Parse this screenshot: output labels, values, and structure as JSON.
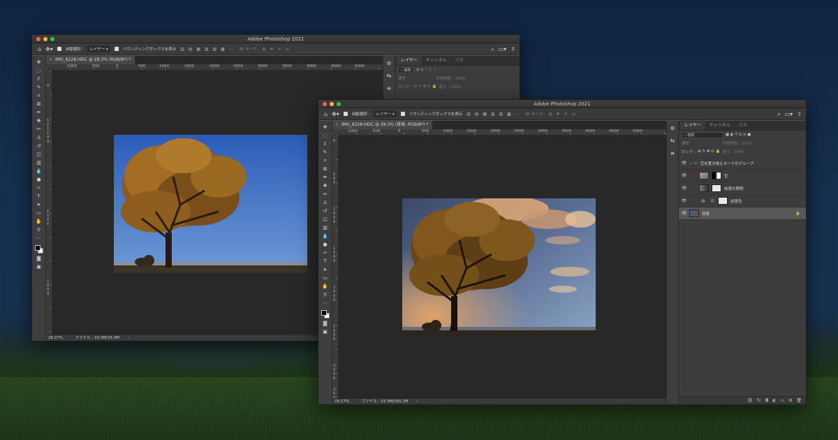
{
  "desktop": {
    "description": "night landscape wallpaper"
  },
  "window_back": {
    "title": "Adobe Photoshop 2021",
    "options": {
      "auto_select_label": "自動選択 :",
      "layer_select": "レイヤー",
      "bbox_label": "バウンディングボックスを表示",
      "threed_mode": "3D モード:"
    },
    "doc_tab": "IMG_6228.HEIC @ 28.3% (RGB/8*) *",
    "ruler_h": [
      "1000",
      "500",
      "0",
      "500",
      "1000",
      "1500",
      "2000",
      "2500",
      "3000",
      "3500",
      "4000",
      "4500",
      "5000"
    ],
    "ruler_v": [
      "0",
      "5",
      "0",
      "1",
      "0",
      "0",
      "0",
      "1",
      "5",
      "0",
      "0",
      "2",
      "0",
      "0",
      "0"
    ],
    "status": {
      "zoom": "28.27%",
      "file": "ファイル : 33.3M/33.3M"
    },
    "panel": {
      "tabs": [
        "レイヤー",
        "チャンネル",
        "パス"
      ],
      "search": "種類",
      "blend": "通常",
      "opacity": "不透明度 : 100%",
      "lock": "ロック :",
      "fill": "塗り : 100%"
    }
  },
  "window_front": {
    "title": "Adobe Photoshop 2021",
    "options": {
      "auto_select_label": "自動選択 :",
      "layer_select": "レイヤー",
      "bbox_label": "バウンディングボックスを表示",
      "threed_mode": "3D モード:"
    },
    "doc_tab": "IMG_6228.HEIC @ 28.3% (背景, RGB/8*) *",
    "ruler_h": [
      "1000",
      "500",
      "0",
      "500",
      "1000",
      "1500",
      "2000",
      "2500",
      "3000",
      "3500",
      "4000",
      "4500",
      "5000"
    ],
    "ruler_v": [
      "0",
      "5",
      "0",
      "0",
      "1",
      "0",
      "0",
      "0",
      "1",
      "5",
      "0",
      "0",
      "2",
      "0",
      "0",
      "0",
      "2",
      "5",
      "0",
      "0",
      "3",
      "0",
      "0",
      "0",
      "3",
      "5",
      "0",
      "0",
      "4",
      "0"
    ],
    "status": {
      "zoom": "28.27%",
      "file": "ファイル : 33.3M/160.2M"
    },
    "panel": {
      "tabs": [
        "レイヤー",
        "チャンネル",
        "パス"
      ],
      "search": "種類",
      "blend": "通常",
      "opacity": "不透明度 : 100%",
      "lock": "ロック :",
      "fill": "塗り : 100%",
      "layers": [
        {
          "name": "空を置き換えモードのグループ",
          "kind": "group"
        },
        {
          "name": "空",
          "kind": "sky"
        },
        {
          "name": "前景の照明",
          "kind": "adjust"
        },
        {
          "name": "前景色",
          "kind": "adjust"
        },
        {
          "name": "背景",
          "kind": "background",
          "selected": true
        }
      ],
      "footer_icons": [
        "link-icon",
        "fx-icon",
        "mask-icon",
        "adjustment-icon",
        "folder-icon",
        "new-layer-icon",
        "trash-icon"
      ]
    }
  },
  "colors": {
    "panel_bg": "#3c3c3c",
    "canvas_bg": "#282828",
    "chrome": "#535353"
  }
}
